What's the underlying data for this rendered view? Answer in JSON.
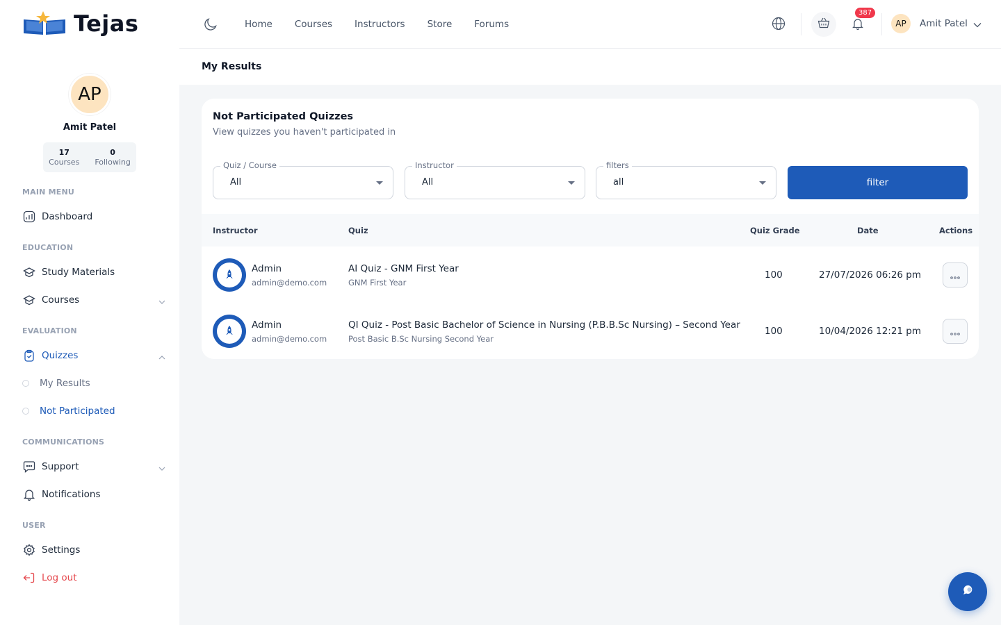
{
  "brand": {
    "name": "Tejas"
  },
  "profile": {
    "initials": "AP",
    "name": "Amit Patel",
    "courses_count": "17",
    "courses_label": "Courses",
    "following_count": "0",
    "following_label": "Following"
  },
  "sidebar": {
    "main_menu_title": "MAIN MENU",
    "dashboard": "Dashboard",
    "education_title": "EDUCATION",
    "study_materials": "Study Materials",
    "courses": "Courses",
    "evaluation_title": "EVALUATION",
    "quizzes": "Quizzes",
    "my_results": "My Results",
    "not_participated": "Not Participated",
    "communications_title": "COMMUNICATIONS",
    "support": "Support",
    "notifications": "Notifications",
    "user_title": "USER",
    "settings": "Settings",
    "logout": "Log out"
  },
  "header": {
    "nav": [
      "Home",
      "Courses",
      "Instructors",
      "Store",
      "Forums"
    ],
    "notification_count": "387",
    "user_initials": "AP",
    "user_name": "Amit Patel"
  },
  "page": {
    "title": "My Results"
  },
  "card": {
    "title": "Not Participated Quizzes",
    "subtitle": "View quizzes you haven't participated in",
    "filters": {
      "quiz_course_label": "Quiz / Course",
      "quiz_course_value": "All",
      "instructor_label": "Instructor",
      "instructor_value": "All",
      "filters_label": "filters",
      "filters_value": "all",
      "button": "filter"
    },
    "columns": {
      "instructor": "Instructor",
      "quiz": "Quiz",
      "grade": "Quiz Grade",
      "date": "Date",
      "actions": "Actions"
    },
    "rows": [
      {
        "instructor_name": "Admin",
        "instructor_email": "admin@demo.com",
        "quiz": "AI Quiz - GNM First Year",
        "quiz_sub": "GNM First Year",
        "grade": "100",
        "date": "27/07/2026 06:26 pm"
      },
      {
        "instructor_name": "Admin",
        "instructor_email": "admin@demo.com",
        "quiz": "QI Quiz - Post Basic Bachelor of Science in Nursing (P.B.B.Sc Nursing) – Second Year",
        "quiz_sub": "Post Basic B.Sc Nursing Second Year",
        "grade": "100",
        "date": "10/04/2026 12:21 pm"
      }
    ]
  },
  "colors": {
    "primary": "#1e5bb8",
    "danger": "#e5484d",
    "background": "#f4f6f8",
    "avatar": "#fde4c0"
  },
  "icons": {
    "logo": "book-star-logo",
    "theme": "moon-icon",
    "language": "globe-icon",
    "cart": "basket-icon",
    "notifications": "bell-icon",
    "chat": "chat-bubble-icon"
  }
}
